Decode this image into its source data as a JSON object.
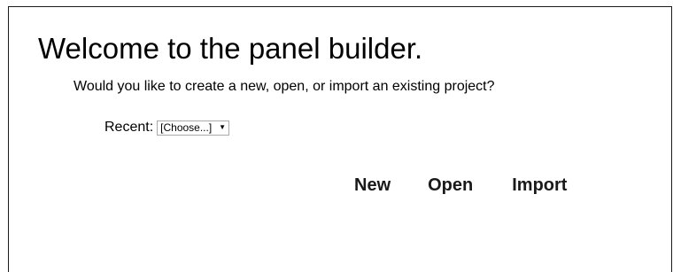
{
  "welcome": {
    "title": "Welcome to the panel builder.",
    "prompt": "Would you like to create a new, open, or import an existing project?"
  },
  "recent": {
    "label": "Recent:",
    "selected": "[Choose...]"
  },
  "actions": {
    "new_label": "New",
    "open_label": "Open",
    "import_label": "Import"
  },
  "icons": {
    "select_arrow": "chevron-down-icon"
  }
}
